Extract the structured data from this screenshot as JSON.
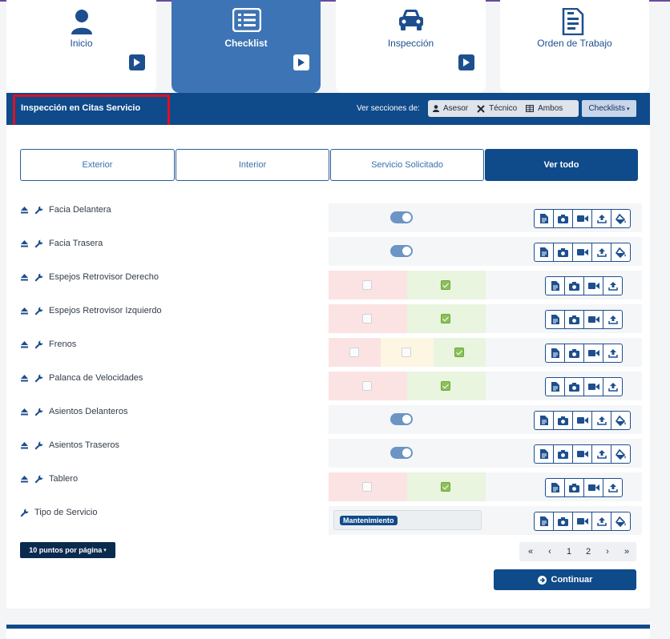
{
  "nav": {
    "items": [
      {
        "label": "Inicio",
        "icon": "user-icon"
      },
      {
        "label": "Checklist",
        "icon": "list-icon"
      },
      {
        "label": "Inspección",
        "icon": "car-icon"
      },
      {
        "label": "Orden de Trabajo",
        "icon": "document-icon"
      }
    ],
    "active": "Checklist"
  },
  "header": {
    "title": "Inspección en Citas Servicio",
    "view_label": "Ver secciones de:",
    "views": [
      "Asesor",
      "Técnico",
      "Ambos"
    ],
    "checklists_label": "Checklists"
  },
  "tabs": [
    "Exterior",
    "Interior",
    "Servicio Solicitado",
    "Ver todo"
  ],
  "active_tab": "Ver todo",
  "items": [
    {
      "label": "Facia Delantera",
      "control": "toggle",
      "on": true
    },
    {
      "label": "Facia Trasera",
      "control": "toggle",
      "on": true
    },
    {
      "label": "Espejos Retrovisor Derecho",
      "control": "checks2",
      "checked": [
        false,
        true
      ]
    },
    {
      "label": "Espejos Retrovisor Izquierdo",
      "control": "checks2",
      "checked": [
        false,
        true
      ]
    },
    {
      "label": "Frenos",
      "control": "checks3",
      "checked": [
        false,
        false,
        true
      ]
    },
    {
      "label": "Palanca de Velocidades",
      "control": "checks2",
      "checked": [
        false,
        true
      ]
    },
    {
      "label": "Asientos Delanteros",
      "control": "toggle",
      "on": true
    },
    {
      "label": "Asientos Traseros",
      "control": "toggle",
      "on": true
    },
    {
      "label": "Tablero",
      "control": "checks2",
      "checked": [
        false,
        true
      ]
    },
    {
      "label": "Tipo de Servicio",
      "control": "tag",
      "value": "Mantenimiento"
    }
  ],
  "pagination": {
    "per_page_label": "10 puntos por página",
    "pages": [
      "1",
      "2"
    ]
  },
  "continue_label": "Continuar",
  "colors": {
    "primary": "#0f4a8a",
    "active_card": "#3d74b5",
    "check_red_bg": "#fbe3e3",
    "check_yellow_bg": "#fdf6e3",
    "check_green_bg": "#e9f5df",
    "highlight_red": "#e01020"
  }
}
